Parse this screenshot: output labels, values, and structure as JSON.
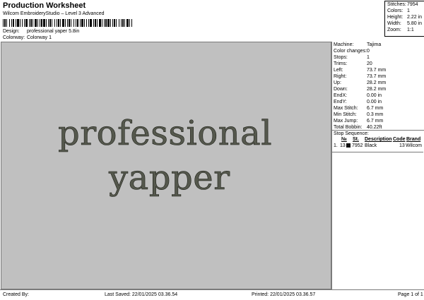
{
  "header": {
    "title": "Production Worksheet",
    "subtitle": "Wilcom EmbroideryStudio – Level 3 Advanced"
  },
  "design": {
    "design_label": "Design:",
    "design_value": "professional yaper 5.8in",
    "colorway_label": "Colorway:",
    "colorway_value": "Colorway 1"
  },
  "summary": [
    {
      "label": "Stitches:",
      "value": "7954"
    },
    {
      "label": "Colors:",
      "value": "1"
    },
    {
      "label": "Height:",
      "value": "2.22 in"
    },
    {
      "label": "Width:",
      "value": "5.80 in"
    },
    {
      "label": "Zoom:",
      "value": "1:1"
    }
  ],
  "embroidery_text": {
    "line1": "professional",
    "line2": "yapper"
  },
  "machine_info": [
    {
      "label": "Machine:",
      "value": "Tajima"
    },
    {
      "label": "Color changes:",
      "value": "0"
    },
    {
      "label": "Stops:",
      "value": "1"
    },
    {
      "label": "Trims:",
      "value": "20"
    },
    {
      "label": "Left:",
      "value": "73.7 mm"
    },
    {
      "label": "Right:",
      "value": "73.7 mm"
    },
    {
      "label": "Up:",
      "value": "28.2 mm"
    },
    {
      "label": "Down:",
      "value": "28.2 mm"
    },
    {
      "label": "EndX:",
      "value": "0.00 in"
    },
    {
      "label": "EndY:",
      "value": "0.00 in"
    },
    {
      "label": "Max Stitch:",
      "value": "6.7 mm"
    },
    {
      "label": "Min Stitch:",
      "value": "0.3 mm"
    },
    {
      "label": "Max Jump:",
      "value": "6.7 mm"
    },
    {
      "label": "Total Bobbin:",
      "value": "40.22ft"
    }
  ],
  "stop_sequence": {
    "title": "Stop Sequence:",
    "headers": [
      "№",
      "St.",
      "Description",
      "Code",
      "Brand"
    ],
    "rows": [
      {
        "index": "1.",
        "no": "13",
        "swatch_color": "#111111",
        "stitches": "7952",
        "description": "Black",
        "code": "13",
        "brand": "Wilcom"
      }
    ]
  },
  "footer": {
    "created": "Created By:",
    "last_saved": "Last Saved: 22/01/2025 03.36.54",
    "printed": "Printed: 22/01/2025 03.36.57",
    "page": "Page 1 of 1"
  },
  "colors": {
    "canvas_bg": "#c0c0c0",
    "thread": "#55584d"
  }
}
